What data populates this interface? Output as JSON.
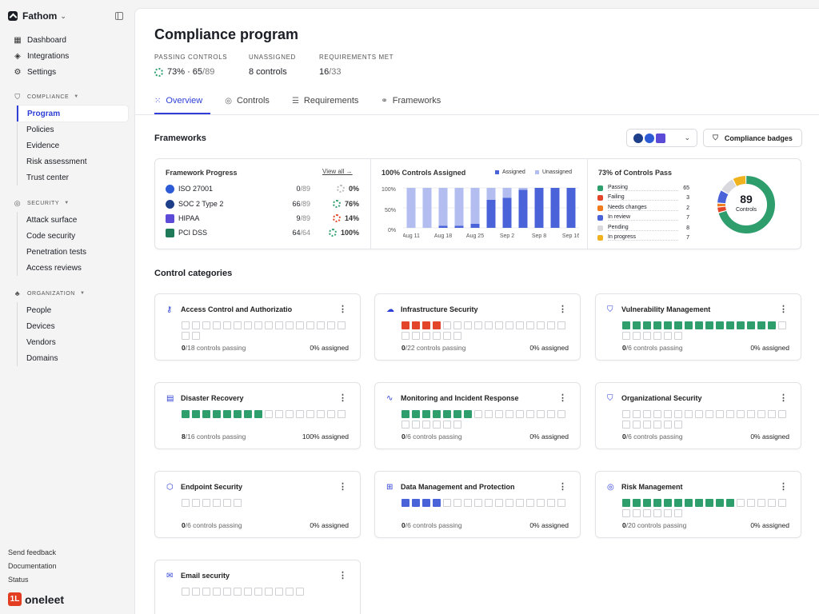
{
  "workspace": {
    "name": "Fathom"
  },
  "nav": {
    "top": [
      {
        "label": "Dashboard",
        "icon": "grid-icon"
      },
      {
        "label": "Integrations",
        "icon": "integrations-icon"
      },
      {
        "label": "Settings",
        "icon": "gear-icon"
      }
    ],
    "sections": [
      {
        "title": "COMPLIANCE",
        "icon": "shield-icon",
        "items": [
          "Program",
          "Policies",
          "Evidence",
          "Risk assessment",
          "Trust center"
        ],
        "active": 0
      },
      {
        "title": "SECURITY",
        "icon": "radar-icon",
        "items": [
          "Attack surface",
          "Code security",
          "Penetration tests",
          "Access reviews"
        ]
      },
      {
        "title": "ORGANIZATION",
        "icon": "org-icon",
        "items": [
          "People",
          "Devices",
          "Vendors",
          "Domains"
        ]
      }
    ],
    "footer": [
      "Send feedback",
      "Documentation",
      "Status"
    ],
    "brand": "oneleet"
  },
  "page": {
    "title": "Compliance program",
    "kpis": [
      {
        "label": "PASSING CONTROLS",
        "value": "73% · 65",
        "muted": "/89"
      },
      {
        "label": "UNASSIGNED",
        "value": "8 controls",
        "muted": ""
      },
      {
        "label": "REQUIREMENTS MET",
        "value": "16",
        "muted": "/33"
      }
    ],
    "tabs": [
      {
        "label": "Overview",
        "icon": "dots-grid-icon"
      },
      {
        "label": "Controls",
        "icon": "target-icon"
      },
      {
        "label": "Requirements",
        "icon": "list-icon"
      },
      {
        "label": "Frameworks",
        "icon": "frameworks-icon"
      }
    ],
    "active_tab": 0
  },
  "frameworks": {
    "heading": "Frameworks",
    "badges_button": "Compliance badges",
    "progress": {
      "title": "Framework Progress",
      "view_all": "View all",
      "rows": [
        {
          "name": "ISO 27001",
          "done": "0",
          "total": "/89",
          "pct": "0%",
          "color": "#2d5bd6"
        },
        {
          "name": "SOC 2 Type 2",
          "done": "66",
          "total": "/89",
          "pct": "76%",
          "color": "#1d3f8a"
        },
        {
          "name": "HIPAA",
          "done": "9",
          "total": "/89",
          "pct": "14%",
          "color": "#5b4bd6"
        },
        {
          "name": "PCI DSS",
          "done": "64",
          "total": "/64",
          "pct": "100%",
          "color": "#1f7a5a"
        }
      ]
    },
    "assigned_chart": {
      "title": "100% Controls Assigned",
      "legend": [
        "Assigned",
        "Unassigned"
      ]
    },
    "pass_chart": {
      "title": "73% of Controls Pass",
      "total": "89",
      "total_label": "Controls",
      "rows": [
        {
          "label": "Passing",
          "value": "65",
          "color": "#2e9e6d"
        },
        {
          "label": "Failing",
          "value": "3",
          "color": "#e2452a"
        },
        {
          "label": "Needs changes",
          "value": "2",
          "color": "#f07b1f"
        },
        {
          "label": "In review",
          "value": "7",
          "color": "#4a63d9"
        },
        {
          "label": "Pending",
          "value": "8",
          "color": "#d9d9dd"
        },
        {
          "label": "In progress",
          "value": "7",
          "color": "#f0b21f"
        }
      ]
    }
  },
  "chart_data": {
    "type": "bar",
    "title": "100% Controls Assigned",
    "categories": [
      "Aug 11",
      "",
      "Aug 18",
      "",
      "Aug 25",
      "",
      "Sep 2",
      "",
      "Sep 8",
      "",
      "Sep 16"
    ],
    "ylim": [
      0,
      100
    ],
    "yticks": [
      "100%",
      "50%",
      "0%"
    ],
    "series": [
      {
        "name": "Assigned",
        "values": [
          0,
          0,
          5,
          5,
          10,
          70,
          75,
          95,
          100,
          100,
          100
        ]
      },
      {
        "name": "Unassigned",
        "values": [
          100,
          100,
          95,
          95,
          90,
          30,
          25,
          5,
          0,
          0,
          0
        ]
      }
    ],
    "colors": {
      "Assigned": "#4a63d9",
      "Unassigned": "#b3bdf0"
    }
  },
  "categories": {
    "heading": "Control categories",
    "cards": [
      {
        "title": "Access Control and Authorizatio",
        "icon": "key-icon",
        "passing": "0",
        "total": "/18 controls passing",
        "assigned": "0% assigned",
        "cells": 18,
        "filled": 0,
        "fill": "#2e9e6d"
      },
      {
        "title": "Infrastructure Security",
        "icon": "cloud-icon",
        "passing": "0",
        "total": "/22 controls passing",
        "assigned": "0% assigned",
        "cells": 22,
        "filled": 4,
        "fill": "#e2452a"
      },
      {
        "title": "Vulnerability Management",
        "icon": "shield-icon",
        "passing": "0",
        "total": "/6 controls passing",
        "assigned": "0% assigned",
        "cells": 22,
        "filled": 15,
        "fill": "#2e9e6d"
      },
      {
        "title": "Disaster Recovery",
        "icon": "server-icon",
        "passing": "8",
        "total": "/16 controls passing",
        "assigned": "100% assigned",
        "cells": 16,
        "filled": 8,
        "fill": "#2e9e6d"
      },
      {
        "title": "Monitoring and Incident Response",
        "icon": "pulse-icon",
        "passing": "0",
        "total": "/6 controls passing",
        "assigned": "0% assigned",
        "cells": 22,
        "filled": 7,
        "fill": "#2e9e6d"
      },
      {
        "title": "Organizational Security",
        "icon": "shield-icon",
        "passing": "0",
        "total": "/6 controls passing",
        "assigned": "0% assigned",
        "cells": 22,
        "filled": 0,
        "fill": "#2e9e6d"
      },
      {
        "title": "Endpoint Security",
        "icon": "cube-icon",
        "passing": "0",
        "total": "/6 controls passing",
        "assigned": "0% assigned",
        "cells": 6,
        "filled": 0,
        "fill": "#2e9e6d"
      },
      {
        "title": "Data Management and Protection",
        "icon": "data-grid-icon",
        "passing": "0",
        "total": "/6 controls passing",
        "assigned": "0% assigned",
        "cells": 16,
        "filled": 4,
        "fill": "#4a63d9"
      },
      {
        "title": "Risk Management",
        "icon": "radar-icon",
        "passing": "0",
        "total": "/20 controls passing",
        "assigned": "0% assigned",
        "cells": 22,
        "filled": 11,
        "fill": "#2e9e6d"
      },
      {
        "title": "Email security",
        "icon": "mail-icon",
        "passing": "",
        "total": "",
        "assigned": "",
        "cells": 12,
        "filled": 0,
        "fill": "#2e9e6d"
      }
    ]
  }
}
